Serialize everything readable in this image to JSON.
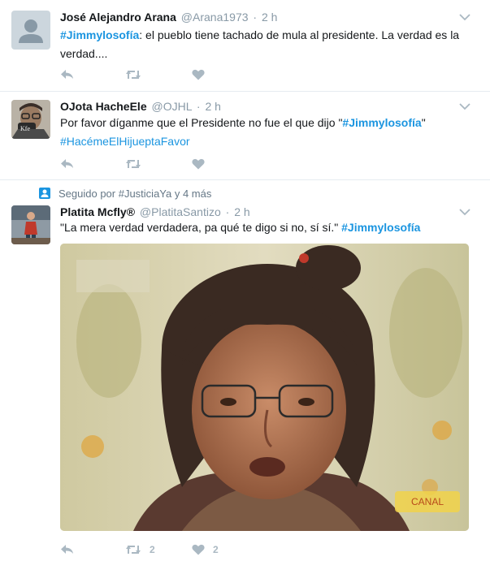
{
  "tweets": [
    {
      "name": "José Alejandro Arana",
      "handle": "@Arana1973",
      "sep": "·",
      "time": "2 h",
      "hashtag": "#Jimmylosofía",
      "text_line1_rest": ": el pueblo tiene tachado de mula al presidente. La verdad es la",
      "text_line2": "verdad...."
    },
    {
      "name": "OJota HacheEle",
      "handle": "@OJHL",
      "sep": "·",
      "time": "2 h",
      "text_line1_pre": "Por favor díganme que el Presidente no fue el que dijo \"",
      "hashtag": "#Jimmylosofía",
      "text_line1_post": "\"",
      "hashtag2": "#HacémeElHijueptaFavor",
      "mug_text": "Kfe"
    },
    {
      "social_context": "Seguido por #JusticiaYa y 4 más",
      "name": "Platita Mcfly®",
      "handle": "@PlatitaSantizo",
      "sep": "·",
      "time": "2 h",
      "text_pre": "\"La mera verdad verdadera, pa qué te digo si no, sí sí.\" ",
      "hashtag": "#Jimmylosofía",
      "retweet_count": "2",
      "like_count": "2",
      "media_watermark": "CANAL"
    }
  ],
  "icons": {
    "reply": "reply-icon",
    "retweet": "retweet-icon",
    "like": "heart-icon",
    "caret": "chevron-down-icon",
    "follow": "follow-person-icon"
  },
  "colors": {
    "hashtag": "#1b95e0",
    "icon_gray": "#aab8c2",
    "meta_gray": "#8899a6",
    "border": "#e6ecf0"
  }
}
